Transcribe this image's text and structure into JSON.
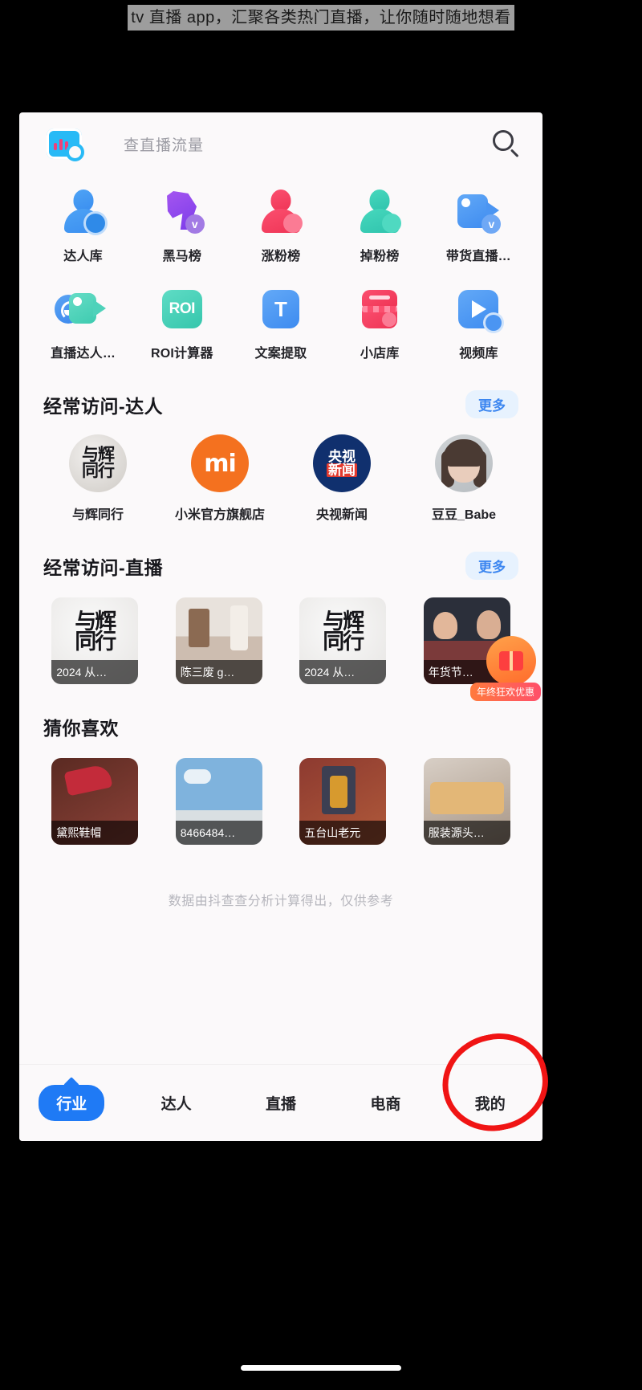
{
  "caption": {
    "text": "tv 直播 app，汇聚各类热门直播，让你随时随地想看"
  },
  "app": {
    "logo_icon": "chat-bars-logo-icon",
    "search_placeholder": "查直播流量",
    "search_icon": "search-icon"
  },
  "tools_row1": [
    {
      "label": "达人库",
      "icon": "person-blue-icon"
    },
    {
      "label": "黑马榜",
      "icon": "dark-horse-icon"
    },
    {
      "label": "涨粉榜",
      "icon": "person-red-icon"
    },
    {
      "label": "掉粉榜",
      "icon": "person-teal-icon"
    },
    {
      "label": "带货直播…",
      "icon": "camcorder-blue-icon"
    }
  ],
  "tools_row2": [
    {
      "label": "直播达人…",
      "icon": "headset-camcorder-icon"
    },
    {
      "label": "ROI计算器",
      "icon": "roi-icon",
      "glyph": "ROI"
    },
    {
      "label": "文案提取",
      "icon": "text-extract-icon",
      "glyph": "T"
    },
    {
      "label": "小店库",
      "icon": "shop-icon"
    },
    {
      "label": "视频库",
      "icon": "video-play-icon"
    }
  ],
  "section_creators": {
    "title": "经常访问-达人",
    "more_label": "更多",
    "items": [
      {
        "label": "与辉同行",
        "avatar": "calligraphy-yuhui",
        "glyph_lines": [
          "一与",
          "辉同",
          "行"
        ]
      },
      {
        "label": "小米官方旗舰店",
        "avatar": "xiaomi-logo",
        "glyph": "mi"
      },
      {
        "label": "央视新闻",
        "avatar": "cctv-news-logo",
        "glyph_lines": [
          "央视",
          "新闻"
        ]
      },
      {
        "label": "豆豆_Babe",
        "avatar": "photo-portrait"
      }
    ]
  },
  "section_lives": {
    "title": "经常访问-直播",
    "more_label": "更多",
    "items": [
      {
        "caption": "2024 从…",
        "thumb": "calligraphy-yuhui-thumb"
      },
      {
        "caption": "陈三废 g…",
        "thumb": "room-photo-thumb"
      },
      {
        "caption": "2024 从…",
        "thumb": "calligraphy-yuhui-thumb"
      },
      {
        "caption": "年货节…",
        "thumb": "stage-photo-thumb"
      }
    ],
    "promo": {
      "badge_icon": "gift-badge-icon",
      "tag_label": "年终狂欢优惠"
    }
  },
  "section_recommend": {
    "title": "猜你喜欢",
    "items": [
      {
        "caption": "黛熙鞋帽",
        "thumb": "red-shoe-thumb"
      },
      {
        "caption": "8466484…",
        "thumb": "sky-ferris-thumb"
      },
      {
        "caption": "五台山老元",
        "thumb": "temple-thumb"
      },
      {
        "caption": "服装源头…",
        "thumb": "clothing-thumb"
      }
    ]
  },
  "footnote": "数据由抖查查分析计算得出，仅供参考",
  "tabbar": {
    "items": [
      {
        "label": "行业",
        "active": true
      },
      {
        "label": "达人",
        "active": false
      },
      {
        "label": "直播",
        "active": false
      },
      {
        "label": "电商",
        "active": false
      },
      {
        "label": "我的",
        "active": false
      }
    ]
  },
  "annotation": {
    "shape": "hand-drawn-red-circle",
    "color": "#f01414",
    "targets": "我的"
  }
}
